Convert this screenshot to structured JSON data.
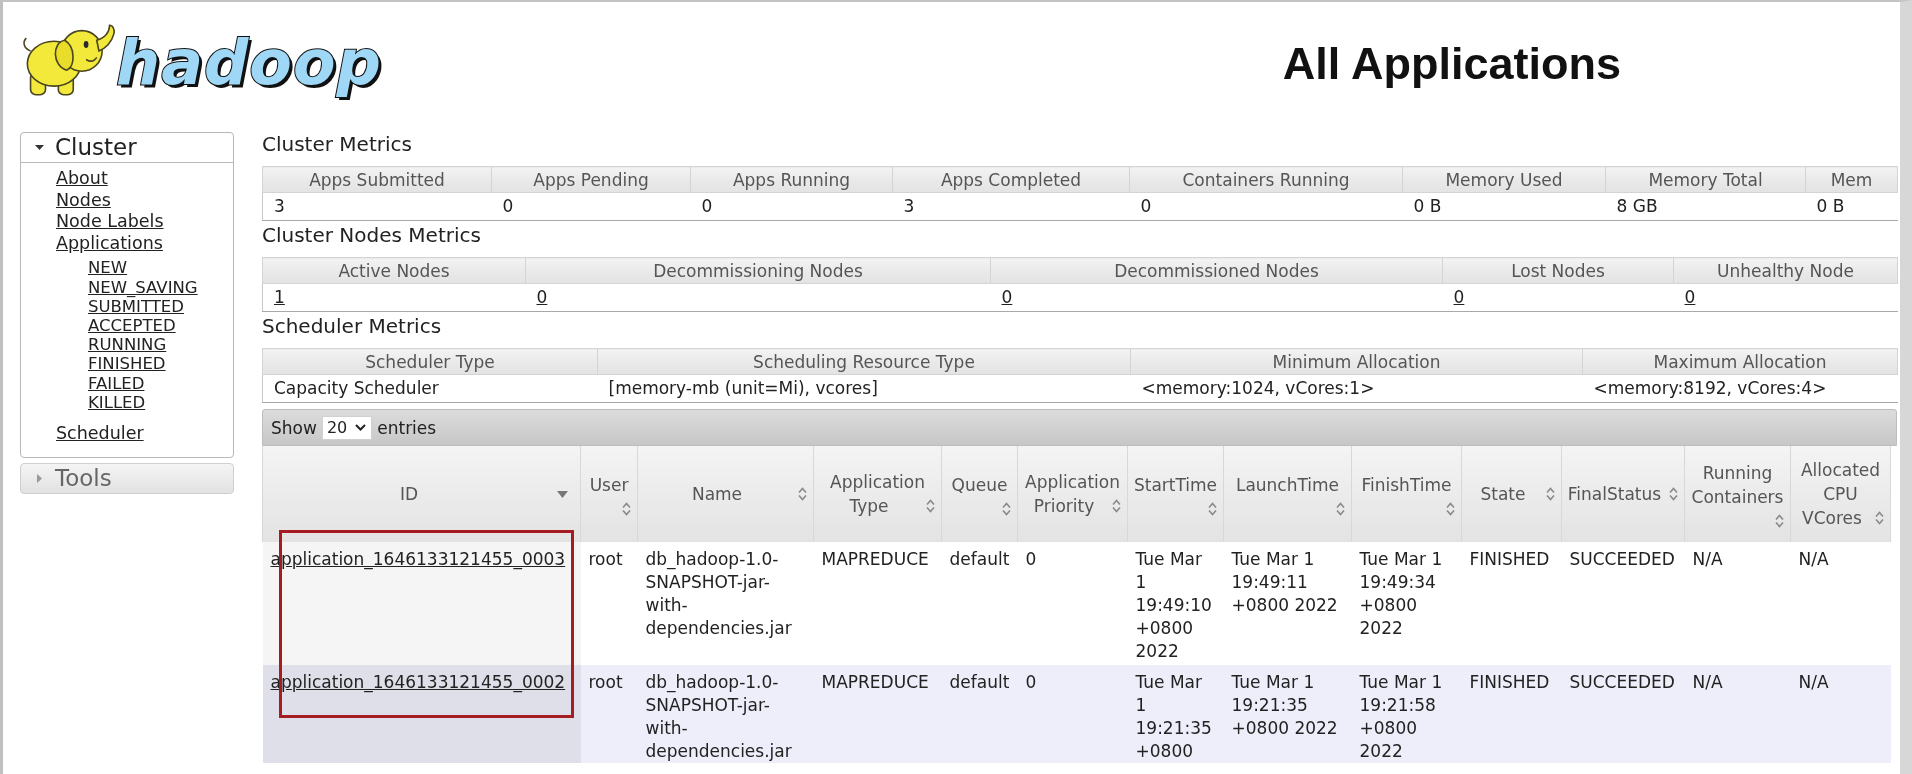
{
  "logo": {
    "wordmark": "hadoop"
  },
  "page_title": "All Applications",
  "sidebar": {
    "sections": [
      {
        "title": "Cluster",
        "expanded": true,
        "items": [
          {
            "label": "About"
          },
          {
            "label": "Nodes"
          },
          {
            "label": "Node Labels"
          },
          {
            "label": "Applications",
            "children": [
              {
                "label": "NEW"
              },
              {
                "label": "NEW_SAVING"
              },
              {
                "label": "SUBMITTED"
              },
              {
                "label": "ACCEPTED"
              },
              {
                "label": "RUNNING"
              },
              {
                "label": "FINISHED"
              },
              {
                "label": "FAILED"
              },
              {
                "label": "KILLED"
              }
            ]
          },
          {
            "label": "Scheduler"
          }
        ]
      },
      {
        "title": "Tools",
        "expanded": false
      }
    ]
  },
  "metric_tables": [
    {
      "title": "Cluster Metrics",
      "kind": "plain",
      "columns": [
        "Apps Submitted",
        "Apps Pending",
        "Apps Running",
        "Apps Completed",
        "Containers Running",
        "Memory Used",
        "Memory Total",
        "Mem"
      ],
      "values": [
        "3",
        "0",
        "0",
        "3",
        "0",
        "0 B",
        "8 GB",
        "0 B"
      ]
    },
    {
      "title": "Cluster Nodes Metrics",
      "kind": "link",
      "columns": [
        "Active Nodes",
        "Decommissioning Nodes",
        "Decommissioned Nodes",
        "Lost Nodes",
        "Unhealthy Node"
      ],
      "values": [
        "1",
        "0",
        "0",
        "0",
        "0"
      ]
    },
    {
      "title": "Scheduler Metrics",
      "kind": "plain",
      "columns": [
        "Scheduler Type",
        "Scheduling Resource Type",
        "Minimum Allocation",
        "Maximum Allocation"
      ],
      "values": [
        "Capacity Scheduler",
        "[memory-mb (unit=Mi), vcores]",
        "<memory:1024, vCores:1>",
        "<memory:8192, vCores:4>"
      ]
    }
  ],
  "entries_control": {
    "prefix": "Show",
    "value": "20",
    "suffix": "entries"
  },
  "apps_table": {
    "columns": [
      {
        "label": "ID",
        "kind": "link",
        "sorted": true,
        "annotated": true
      },
      {
        "label": "User",
        "kind": "text",
        "sorted": false,
        "annotated": false
      },
      {
        "label": "Name",
        "kind": "text",
        "sorted": false,
        "annotated": false
      },
      {
        "label": "Application Type",
        "kind": "text",
        "sorted": false,
        "annotated": false
      },
      {
        "label": "Queue",
        "kind": "text",
        "sorted": false,
        "annotated": false
      },
      {
        "label": "Application Priority",
        "kind": "text",
        "sorted": false,
        "annotated": false
      },
      {
        "label": "StartTime",
        "kind": "text",
        "sorted": false,
        "annotated": false
      },
      {
        "label": "LaunchTime",
        "kind": "text",
        "sorted": false,
        "annotated": false
      },
      {
        "label": "FinishTime",
        "kind": "text",
        "sorted": false,
        "annotated": false
      },
      {
        "label": "State",
        "kind": "text",
        "sorted": false,
        "annotated": false
      },
      {
        "label": "FinalStatus",
        "kind": "text",
        "sorted": false,
        "annotated": false
      },
      {
        "label": "Running Containers",
        "kind": "text",
        "sorted": false,
        "annotated": false
      },
      {
        "label": "Allocated CPU VCores",
        "kind": "text",
        "sorted": false,
        "annotated": false
      }
    ],
    "rows": [
      [
        "application_1646133121455_0003",
        "root",
        "db_hadoop-1.0-SNAPSHOT-jar-with-dependencies.jar",
        "MAPREDUCE",
        "default",
        "0",
        "Tue Mar 1 19:49:10 +0800 2022",
        "Tue Mar 1 19:49:11 +0800 2022",
        "Tue Mar 1 19:49:34 +0800 2022",
        "FINISHED",
        "SUCCEEDED",
        "N/A",
        "N/A"
      ],
      [
        "application_1646133121455_0002",
        "root",
        "db_hadoop-1.0-SNAPSHOT-jar-with-dependencies.jar",
        "MAPREDUCE",
        "default",
        "0",
        "Tue Mar 1 19:21:35 +0800",
        "Tue Mar 1 19:21:35 +0800 2022",
        "Tue Mar 1 19:21:58 +0800 2022",
        "FINISHED",
        "SUCCEEDED",
        "N/A",
        "N/A"
      ]
    ]
  }
}
